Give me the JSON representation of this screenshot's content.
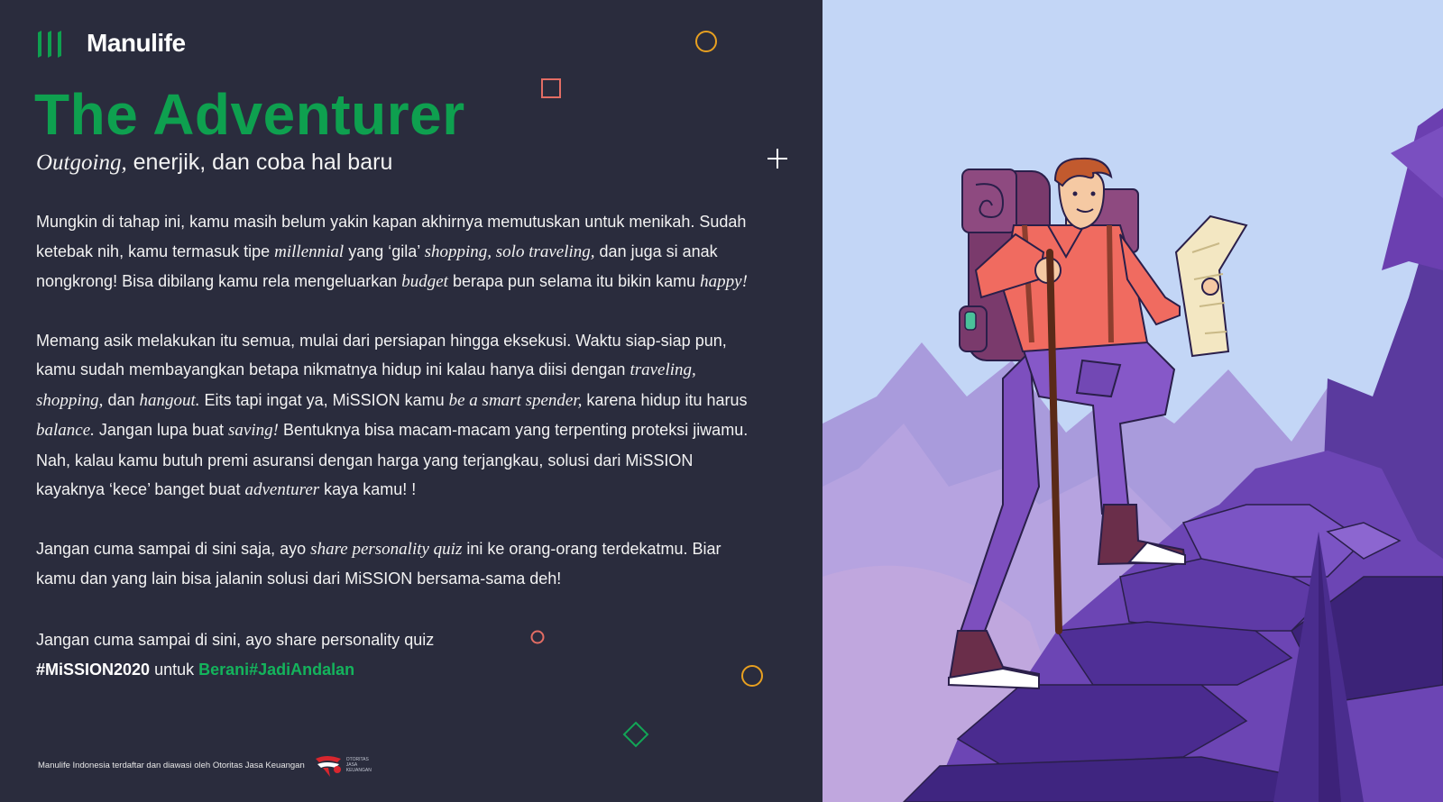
{
  "brand": {
    "name": "Manulife",
    "accent": "#0ea04f"
  },
  "title": "The Adventurer",
  "subtitle": {
    "italic": "Outgoing,",
    "rest": " enerjik, dan coba hal baru"
  },
  "paragraphs": {
    "p1": {
      "t1": "Mungkin di tahap ini, kamu masih belum yakin kapan akhirnya memutuskan untuk menikah. Sudah ketebak nih, kamu termasuk tipe ",
      "i1": "millennial",
      "t2": " yang ‘gila’ ",
      "i2": "shopping, solo traveling,",
      "t3": " dan juga si anak nongkrong! Bisa dibilang kamu rela mengeluarkan ",
      "i3": "budget",
      "t4": " berapa pun selama itu bikin kamu ",
      "i4": "happy!"
    },
    "p2": {
      "t1": "Memang asik melakukan itu semua, mulai dari persiapan hingga eksekusi. Waktu siap-siap pun, kamu sudah membayangkan betapa nikmatnya hidup ini kalau hanya diisi dengan ",
      "i1": "traveling, shopping,",
      "t2": " dan ",
      "i2": "hangout.",
      "t3": " Eits tapi ingat ya, MiSSION kamu ",
      "i3": "be a smart spender,",
      "t4": " karena hidup itu harus ",
      "i4": "balance.",
      "t5": " Jangan lupa buat ",
      "i5": "saving!",
      "t6": " Bentuknya bisa macam-macam yang terpenting proteksi jiwamu. Nah, kalau kamu butuh premi asuransi dengan harga yang terjangkau, solusi dari MiSSION kayaknya ‘kece’ banget buat ",
      "i6": "adventurer",
      "t7": " kaya kamu! !"
    },
    "p3": {
      "t1": "Jangan cuma sampai di sini saja, ayo ",
      "i1": "share personality quiz",
      "t2": " ini ke orang-orang terdekatmu. Biar kamu dan yang lain bisa jalanin solusi dari MiSSION bersama-sama deh!"
    }
  },
  "closing": {
    "line1": "Jangan cuma sampai di sini, ayo share personality quiz",
    "hashtag1": "#MiSSION2020",
    "mid": " untuk ",
    "hashtag2": "Berani#JadiAndalan"
  },
  "footer": {
    "text": "Manulife Indonesia terdaftar dan diawasi oleh Otoritas Jasa Keuangan",
    "ojk_lines": [
      "OTORITAS",
      "JASA",
      "KEUANGAN"
    ]
  },
  "colors": {
    "background": "#2a2c3d",
    "text": "#f2f2f2",
    "hashtag_green": "#14b35c",
    "deco_orange": "#e8a020",
    "deco_salmon": "#e36d64",
    "deco_green": "#12a556",
    "sky": "#c3d6f6"
  },
  "decorations": [
    "circle-outline",
    "square-outline",
    "plus",
    "circle-outline-small",
    "circle-outline",
    "diamond-outline"
  ],
  "illustration": "hiker-with-map-and-walking-stick-climbing-purple-mountain"
}
